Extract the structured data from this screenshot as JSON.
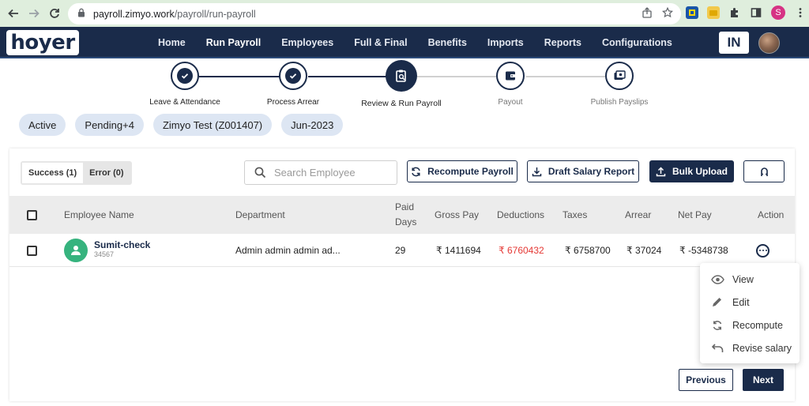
{
  "browser": {
    "url_host": "payroll.zimyo.work",
    "url_path": "/payroll/run-payroll",
    "profile_initial": "S"
  },
  "app": {
    "logo_text": "hoyer",
    "lang_badge": "IN",
    "menu": [
      {
        "label": "Home"
      },
      {
        "label": "Run Payroll"
      },
      {
        "label": "Employees"
      },
      {
        "label": "Full & Final"
      },
      {
        "label": "Benefits"
      },
      {
        "label": "Imports"
      },
      {
        "label": "Reports"
      },
      {
        "label": "Configurations"
      }
    ]
  },
  "stepper": {
    "steps": [
      {
        "label": "Leave & Attendance",
        "status": "done"
      },
      {
        "label": "Process Arrear",
        "status": "done"
      },
      {
        "label": "Review & Run Payroll",
        "status": "current"
      },
      {
        "label": "Payout",
        "status": "pending"
      },
      {
        "label": "Publish Payslips",
        "status": "pending"
      }
    ]
  },
  "filters": {
    "chips": [
      "Active",
      "Pending+4",
      "Zimyo Test (Z001407)",
      "Jun-2023"
    ]
  },
  "toolbar": {
    "tab_success": "Success (1)",
    "tab_error": "Error (0)",
    "search_placeholder": "Search Employee",
    "recompute_label": "Recompute Payroll",
    "draft_report_label": "Draft Salary Report",
    "bulk_upload_label": "Bulk Upload"
  },
  "table": {
    "headers": {
      "employee_name": "Employee Name",
      "department": "Department",
      "paid_days_1": "Paid",
      "paid_days_2": "Days",
      "gross_pay": "Gross Pay",
      "deductions": "Deductions",
      "taxes": "Taxes",
      "arrear": "Arrear",
      "net_pay": "Net Pay",
      "action": "Action"
    },
    "rows": [
      {
        "name": "Sumit-check",
        "emp_id": "34567",
        "department": "Admin admin admin ad...",
        "paid_days": "29",
        "gross_pay": "₹ 1411694",
        "deductions": "₹ 6760432",
        "taxes": "₹ 6758700",
        "arrear": "₹ 37024",
        "net_pay": "₹ -5348738"
      }
    ]
  },
  "action_menu": {
    "view": "View",
    "edit": "Edit",
    "recompute": "Recompute",
    "revise_salary": "Revise salary"
  },
  "pager": {
    "previous": "Previous",
    "next": "Next"
  },
  "colors": {
    "navy": "#1a2b4a",
    "chip_bg": "#dde6f3",
    "negative": "#e53935",
    "avatar_green": "#36b37e"
  }
}
